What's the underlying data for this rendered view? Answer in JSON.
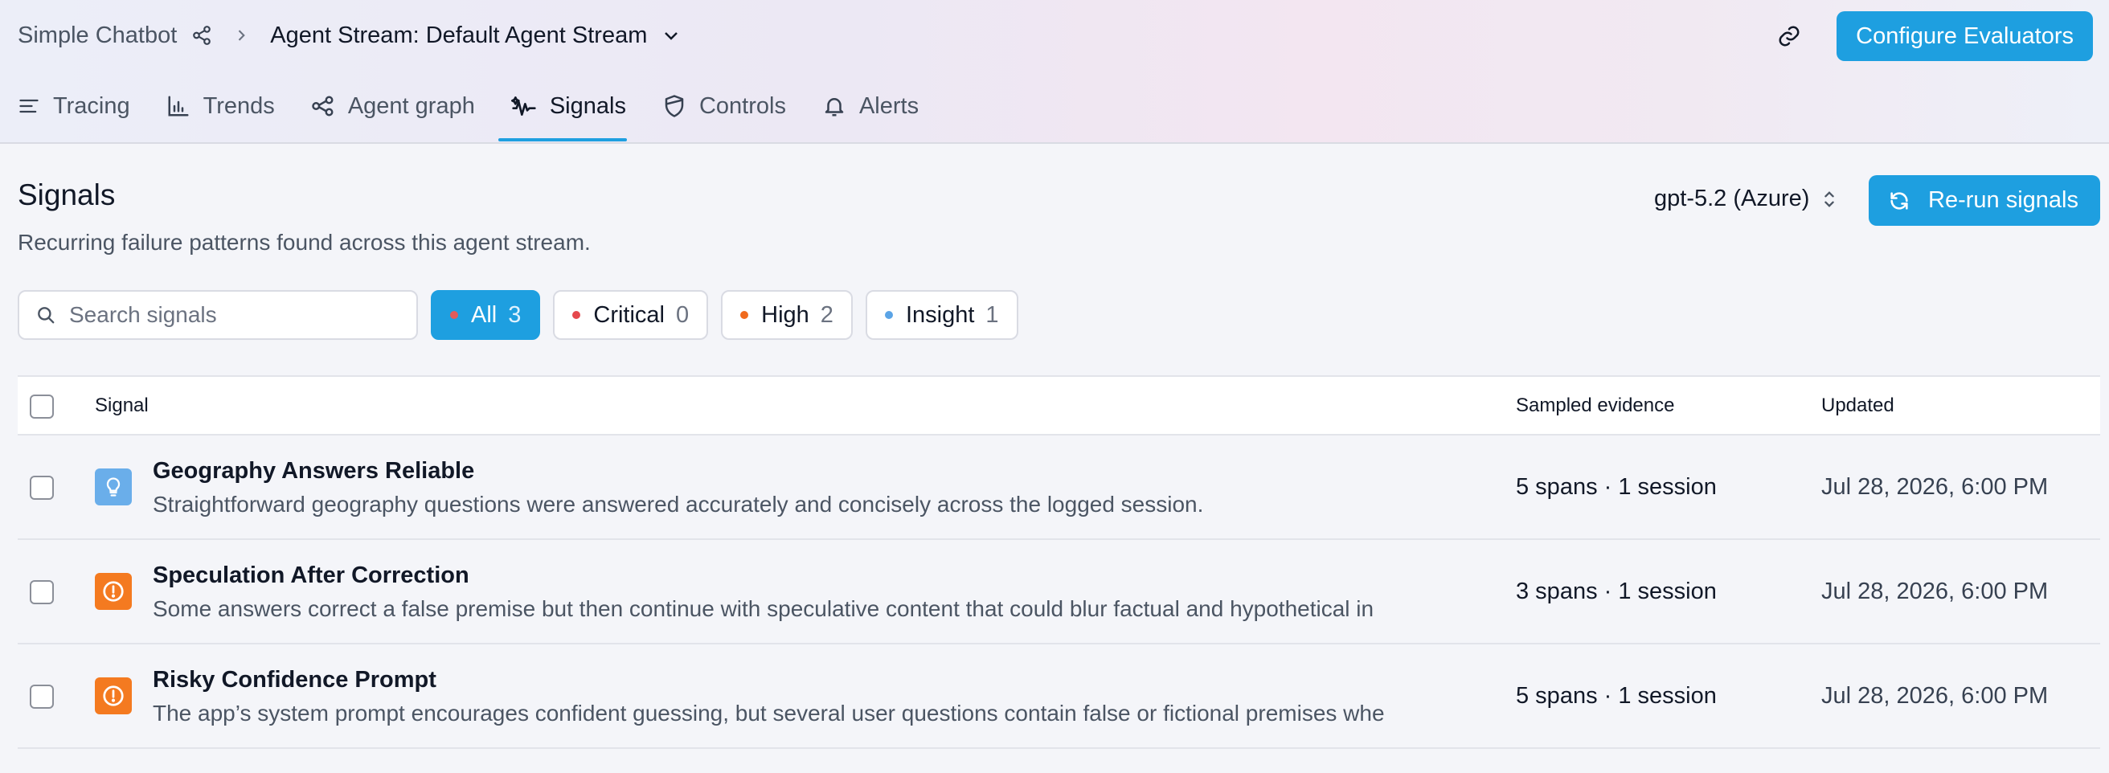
{
  "breadcrumb": {
    "app": "Simple Chatbot",
    "current": "Agent Stream: Default Agent Stream"
  },
  "header": {
    "configure_label": "Configure Evaluators"
  },
  "tabs": [
    {
      "label": "Tracing",
      "icon": "list-icon"
    },
    {
      "label": "Trends",
      "icon": "bar-chart-icon"
    },
    {
      "label": "Agent graph",
      "icon": "graph-icon"
    },
    {
      "label": "Signals",
      "icon": "signal-icon",
      "active": true
    },
    {
      "label": "Controls",
      "icon": "shield-icon"
    },
    {
      "label": "Alerts",
      "icon": "bell-icon"
    }
  ],
  "section": {
    "title": "Signals",
    "subtitle": "Recurring failure patterns found across this agent stream.",
    "model": "gpt-5.2 (Azure)",
    "rerun_label": "Re-run signals"
  },
  "search": {
    "placeholder": "Search signals"
  },
  "filters": [
    {
      "label": "All",
      "count": "3",
      "color": "#e15b5b",
      "active": true
    },
    {
      "label": "Critical",
      "count": "0",
      "color": "#e5484d"
    },
    {
      "label": "High",
      "count": "2",
      "color": "#f06a1d"
    },
    {
      "label": "Insight",
      "count": "1",
      "color": "#5ba4e6"
    }
  ],
  "table": {
    "columns": {
      "signal": "Signal",
      "evidence": "Sampled evidence",
      "updated": "Updated"
    },
    "rows": [
      {
        "title": "Geography Answers Reliable",
        "description": "Straightforward geography questions were answered accurately and concisely across the logged session.",
        "evidence": "5 spans · 1 session",
        "updated": "Jul 28, 2026, 6:00 PM",
        "icon": "lightbulb-icon",
        "color": "#6aaeea"
      },
      {
        "title": "Speculation After Correction",
        "description": "Some answers correct a false premise but then continue with speculative content that could blur factual and hypothetical in",
        "evidence": "3 spans · 1 session",
        "updated": "Jul 28, 2026, 6:00 PM",
        "icon": "alert-icon",
        "color": "#f47a20"
      },
      {
        "title": "Risky Confidence Prompt",
        "description": "The app’s system prompt encourages confident guessing, but several user questions contain false or fictional premises whe",
        "evidence": "5 spans · 1 session",
        "updated": "Jul 28, 2026, 6:00 PM",
        "icon": "alert-icon",
        "color": "#f47a20"
      }
    ]
  }
}
